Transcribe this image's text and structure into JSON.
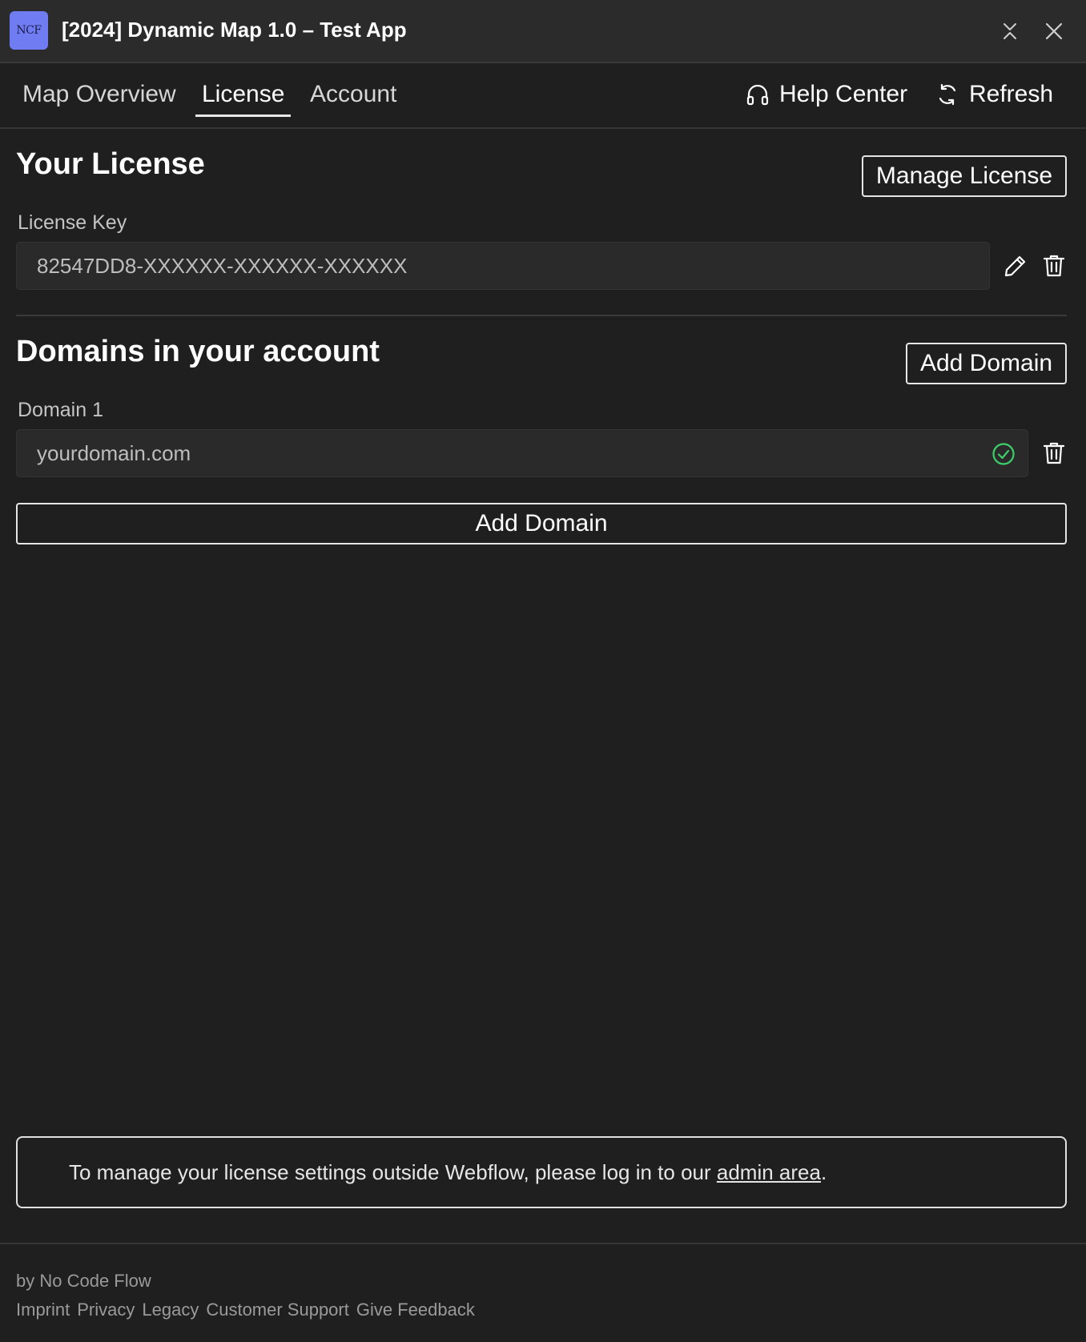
{
  "window": {
    "logo_text": "NCF",
    "title": "[2024] Dynamic Map 1.0 – Test App"
  },
  "tabs": [
    {
      "label": "Map Overview",
      "active": false
    },
    {
      "label": "License",
      "active": true
    },
    {
      "label": "Account",
      "active": false
    }
  ],
  "header_links": {
    "help": "Help Center",
    "refresh": "Refresh"
  },
  "license": {
    "heading": "Your License",
    "manage_button": "Manage License",
    "key_label": "License Key",
    "key_value": "82547DD8-XXXXXX-XXXXXX-XXXXXX"
  },
  "domains": {
    "heading": "Domains in your account",
    "add_button_top": "Add Domain",
    "items": [
      {
        "label": "Domain 1",
        "value": "yourdomain.com",
        "status": "verified"
      }
    ],
    "add_button_full": "Add Domain"
  },
  "notice": {
    "text_before": "To manage your license settings outside Webflow, please log in to our ",
    "link": "admin area",
    "text_after": "."
  },
  "footer": {
    "byline": "by No Code Flow",
    "links": [
      "Imprint",
      "Privacy",
      "Legacy",
      "Customer Support",
      "Give Feedback"
    ]
  },
  "colors": {
    "background": "#1f1f1f",
    "logo_bg": "#6f7cf2",
    "success": "#3ecf6a"
  },
  "icons": [
    "collapse-icon",
    "close-icon",
    "headphones-icon",
    "refresh-icon",
    "pencil-icon",
    "trash-icon",
    "check-circle-icon"
  ]
}
